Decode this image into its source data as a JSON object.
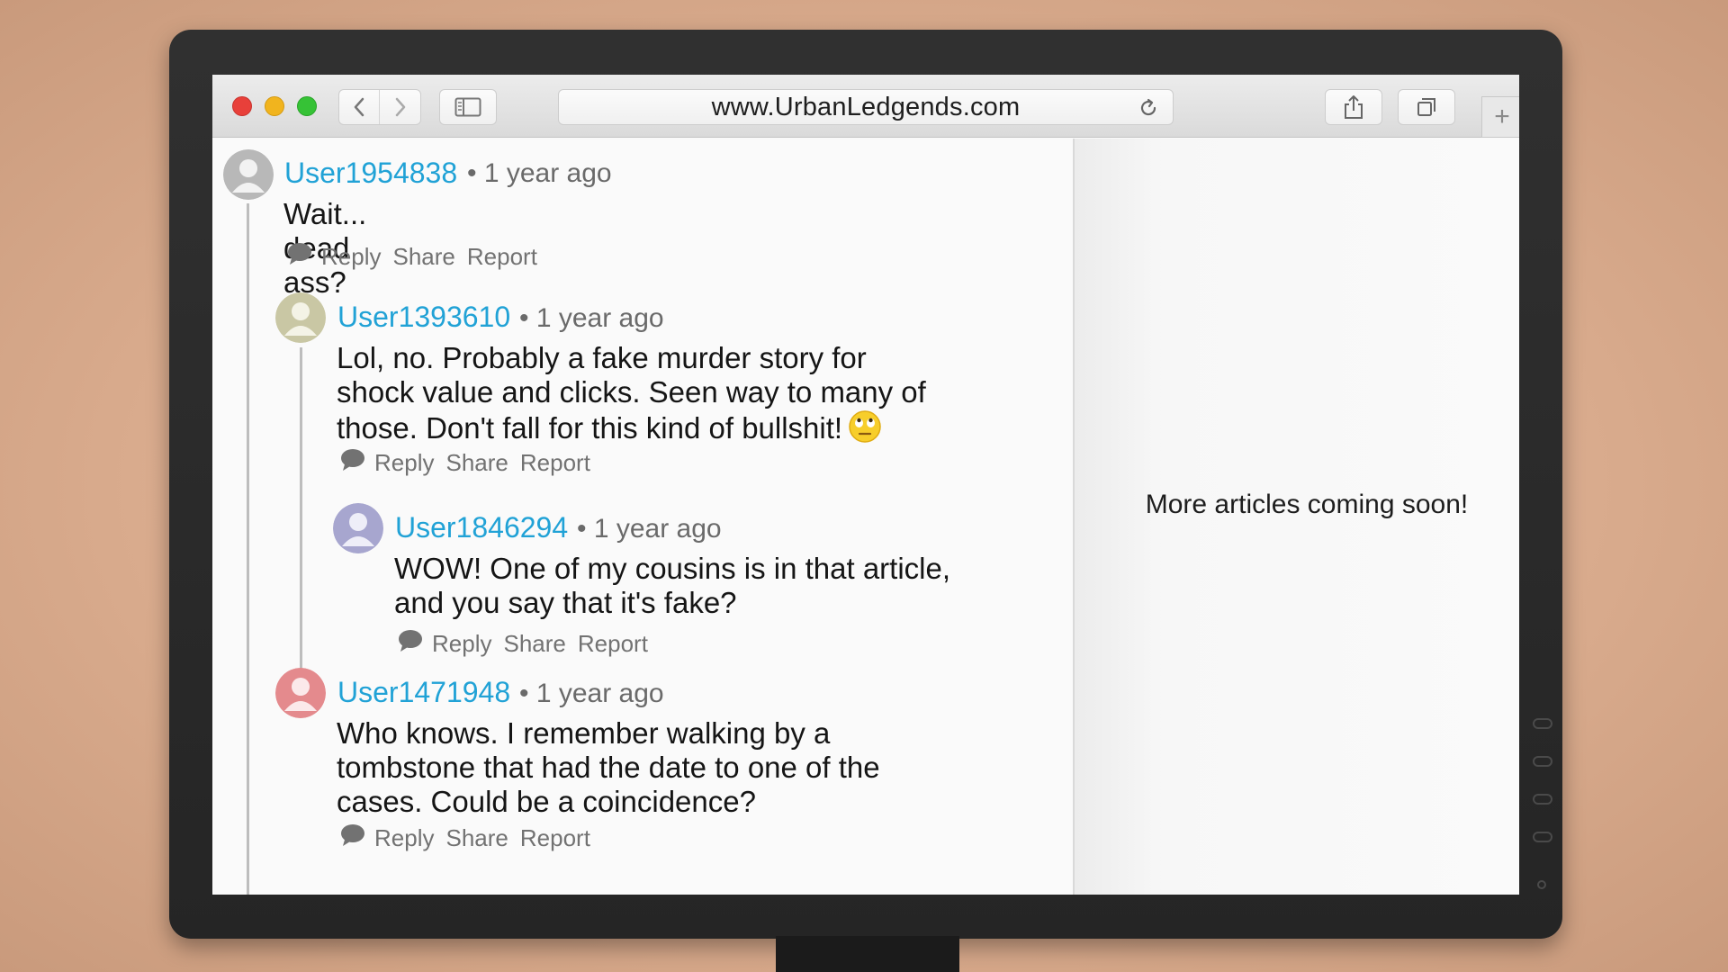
{
  "browser": {
    "url": "www.UrbanLedgends.com",
    "new_tab_label": "+"
  },
  "comments": [
    {
      "username": "User1954838",
      "meta": "• 1 year ago",
      "body_lines": [
        "Wait... dead ass?"
      ],
      "actions": [
        "Reply",
        "Share",
        "Report"
      ],
      "avatar_color": "#b8b8b8"
    },
    {
      "username": "User1393610",
      "meta": "• 1 year ago",
      "body_lines": [
        "Lol, no. Probably a fake murder story for",
        "shock value and clicks. Seen way to many of",
        "those. Don't fall for this kind of bullshit!"
      ],
      "actions": [
        "Reply",
        "Share",
        "Report"
      ],
      "avatar_color": "#c9c7a4"
    },
    {
      "username": "User1846294",
      "meta": "• 1 year ago",
      "body_lines": [
        "WOW! One of my cousins is in that article,",
        "and you say that it's fake?"
      ],
      "actions": [
        "Reply",
        "Share",
        "Report"
      ],
      "avatar_color": "#a7a6cf"
    },
    {
      "username": "User1471948",
      "meta": "• 1 year ago",
      "body_lines": [
        "Who knows. I remember walking by a",
        "tombstone that had the date to one of the",
        "cases. Could be a coincidence?"
      ],
      "actions": [
        "Reply",
        "Share",
        "Report"
      ],
      "avatar_color": "#e48a8d"
    }
  ],
  "sidebar": {
    "message": "More articles coming soon!"
  },
  "icons": [
    "close-icon",
    "minimize-icon",
    "zoom-icon",
    "back-icon",
    "forward-icon",
    "sidebar-icon",
    "reload-icon",
    "share-icon",
    "tabs-icon",
    "comment-bubble-icon",
    "eye-roll-emoji-icon",
    "default-avatar-icon"
  ],
  "colors": {
    "username": "#21a2d6",
    "meta": "#6a6a6a",
    "actions": "#727272"
  }
}
